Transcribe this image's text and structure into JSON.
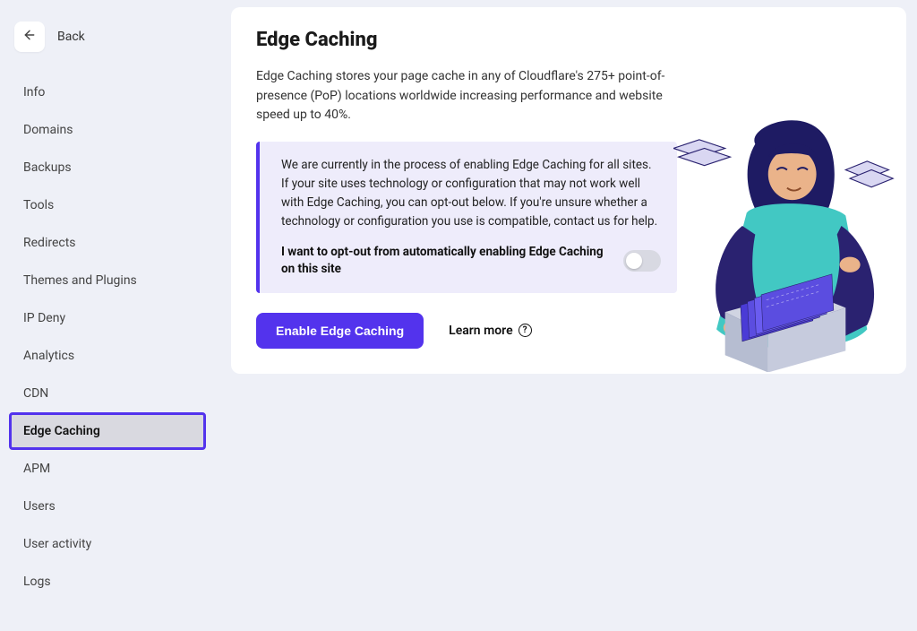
{
  "back": {
    "label": "Back"
  },
  "sidebar": {
    "items": [
      {
        "label": "Info"
      },
      {
        "label": "Domains"
      },
      {
        "label": "Backups"
      },
      {
        "label": "Tools"
      },
      {
        "label": "Redirects"
      },
      {
        "label": "Themes and Plugins"
      },
      {
        "label": "IP Deny"
      },
      {
        "label": "Analytics"
      },
      {
        "label": "CDN"
      },
      {
        "label": "Edge Caching"
      },
      {
        "label": "APM"
      },
      {
        "label": "Users"
      },
      {
        "label": "User activity"
      },
      {
        "label": "Logs"
      }
    ]
  },
  "page": {
    "title": "Edge Caching",
    "description": "Edge Caching stores your page cache in any of Cloudflare's 275+ point-of-presence (PoP) locations worldwide increasing performance and website speed up to 40%.",
    "notice_text": "We are currently in the process of enabling Edge Caching for all sites. If your site uses technology or configuration that may not work well with Edge Caching, you can opt-out below. If you're unsure whether a technology or configuration you use is compatible, contact us for help.",
    "optout_label": "I want to opt-out from automatically enabling Edge Caching on this site",
    "optout_value": false,
    "enable_button": "Enable Edge Caching",
    "learn_more": "Learn more"
  },
  "colors": {
    "accent": "#5333ed",
    "notice_bg": "#eeecfb"
  }
}
